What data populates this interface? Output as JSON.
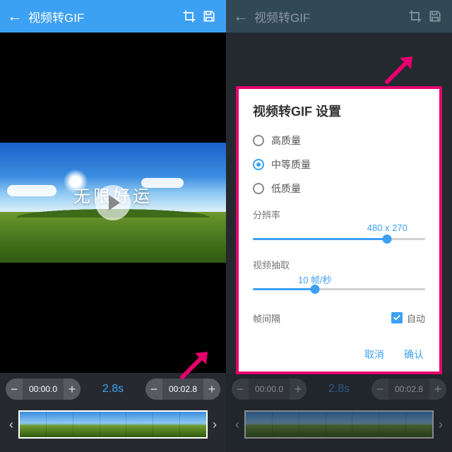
{
  "header": {
    "title": "视频转GIF",
    "back_glyph": "←",
    "crop_icon": "crop",
    "save_icon": "save"
  },
  "preview": {
    "caption": "无限好运"
  },
  "timeline": {
    "start": "00:00.0",
    "end": "00:02.8",
    "duration": "2.8s",
    "minus": "−",
    "plus": "+",
    "prev": "‹",
    "next": "›"
  },
  "settings": {
    "title": "视频转GIF 设置",
    "quality": {
      "options": [
        "高质量",
        "中等质量",
        "低质量"
      ],
      "selected_index": 1
    },
    "resolution": {
      "label": "分辨率",
      "value": "480 x 270",
      "percent": 78
    },
    "fps": {
      "label": "视频抽取",
      "value": "10 帧/秒",
      "percent": 36
    },
    "interval": {
      "label": "帧间隔",
      "auto_label": "自动",
      "auto_checked": true
    },
    "actions": {
      "cancel": "取消",
      "ok": "确认"
    }
  },
  "colors": {
    "accent": "#3ca0f3",
    "annotation": "#e5006d"
  }
}
